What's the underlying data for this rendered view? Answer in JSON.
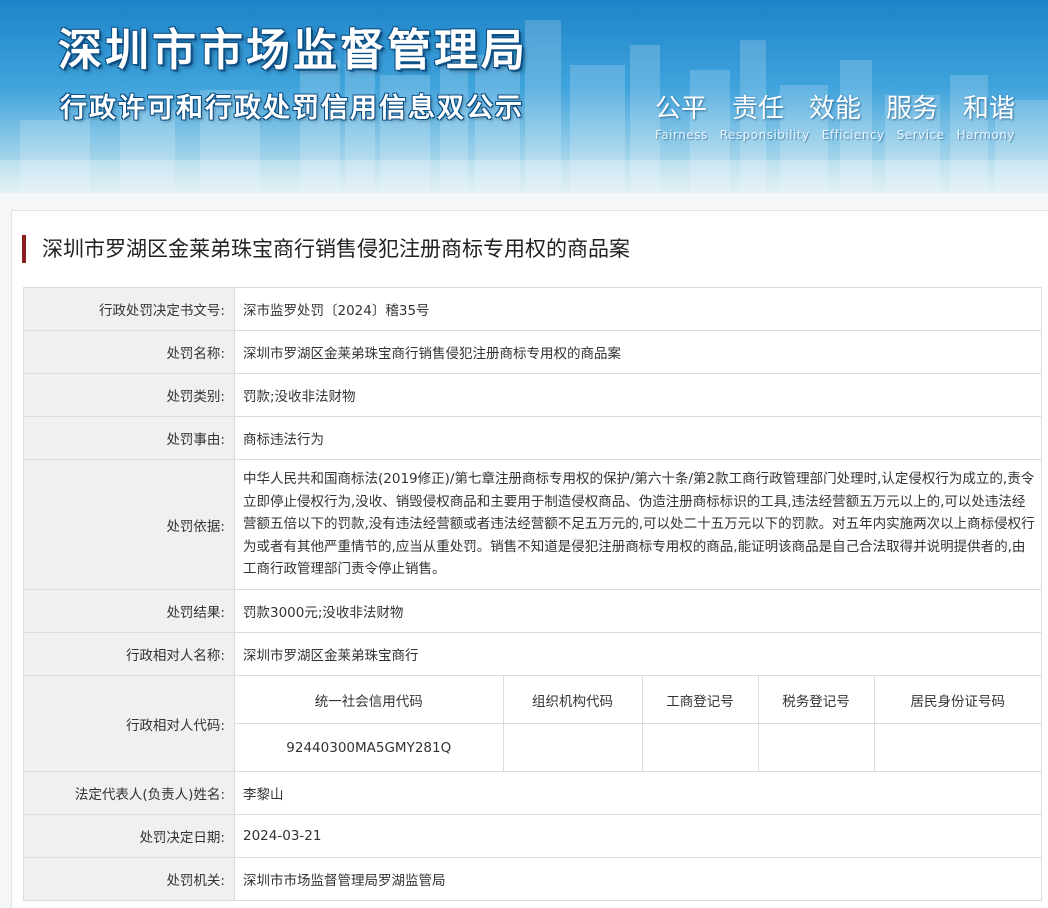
{
  "header": {
    "title": "深圳市市场监督管理局",
    "subtitle": "行政许可和行政处罚信用信息双公示",
    "motto": [
      {
        "cn": "公平",
        "en": "Fairness"
      },
      {
        "cn": "责任",
        "en": "Responsibility"
      },
      {
        "cn": "效能",
        "en": "Efficiency"
      },
      {
        "cn": "服务",
        "en": "Service"
      },
      {
        "cn": "和谐",
        "en": "Harmony"
      }
    ]
  },
  "case": {
    "title": "深圳市罗湖区金莱弟珠宝商行销售侵犯注册商标专用权的商品案",
    "rows": {
      "doc_no": {
        "label": "行政处罚决定书文号:",
        "value": "深市监罗处罚〔2024〕稽35号"
      },
      "name": {
        "label": "处罚名称:",
        "value": "深圳市罗湖区金莱弟珠宝商行销售侵犯注册商标专用权的商品案"
      },
      "category": {
        "label": "处罚类别:",
        "value": "罚款;没收非法财物"
      },
      "reason": {
        "label": "处罚事由:",
        "value": "商标违法行为"
      },
      "basis": {
        "label": "处罚依据:",
        "value": "中华人民共和国商标法(2019修正)/第七章注册商标专用权的保护/第六十条/第2款工商行政管理部门处理时,认定侵权行为成立的,责令立即停止侵权行为,没收、销毁侵权商品和主要用于制造侵权商品、伪造注册商标标识的工具,违法经营额五万元以上的,可以处违法经营额五倍以下的罚款,没有违法经营额或者违法经营额不足五万元的,可以处二十五万元以下的罚款。对五年内实施两次以上商标侵权行为或者有其他严重情节的,应当从重处罚。销售不知道是侵犯注册商标专用权的商品,能证明该商品是自己合法取得并说明提供者的,由工商行政管理部门责令停止销售。"
      },
      "result": {
        "label": "处罚结果:",
        "value": "罚款3000元;没收非法财物"
      },
      "party": {
        "label": "行政相对人名称:",
        "value": "深圳市罗湖区金莱弟珠宝商行"
      },
      "party_code": {
        "label": "行政相对人代码:",
        "headers": [
          "统一社会信用代码",
          "组织机构代码",
          "工商登记号",
          "税务登记号",
          "居民身份证号码"
        ],
        "values": [
          "92440300MA5GMY281Q",
          "",
          "",
          "",
          ""
        ]
      },
      "legal_rep": {
        "label": "法定代表人(负责人)姓名:",
        "value": "李黎山"
      },
      "date": {
        "label": "处罚决定日期:",
        "value": "2024-03-21"
      },
      "authority": {
        "label": "处罚机关:",
        "value": "深圳市市场监督管理局罗湖监管局"
      }
    }
  },
  "colors": {
    "accent_bar": "#8b1c1c",
    "label_bg": "#f0f0f0",
    "banner_top": "#1e84c8"
  }
}
